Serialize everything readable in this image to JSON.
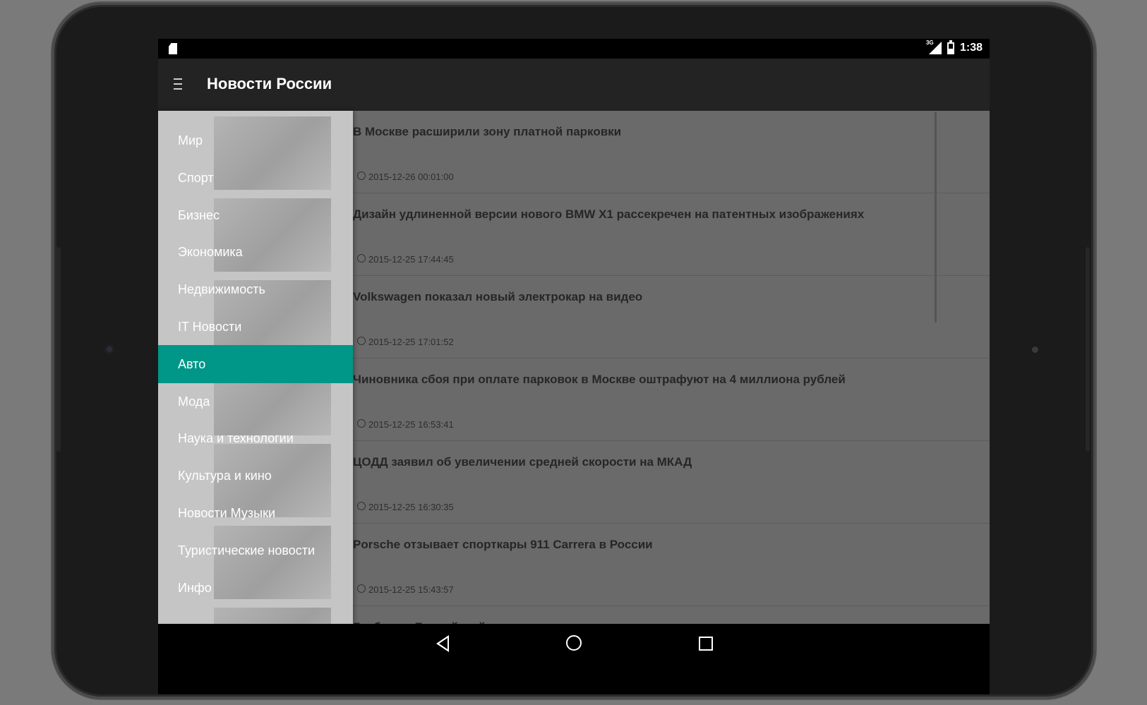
{
  "status_bar": {
    "time": "1:38",
    "network": "3G"
  },
  "app_bar": {
    "title": "Новости России",
    "menu_icon": "hamburger-icon"
  },
  "drawer": {
    "items": [
      {
        "label": "Мир"
      },
      {
        "label": "Спорт"
      },
      {
        "label": "Бизнес"
      },
      {
        "label": "Экономика"
      },
      {
        "label": "Недвижимость"
      },
      {
        "label": "IT Новости"
      },
      {
        "label": "Авто",
        "active": true
      },
      {
        "label": "Мода"
      },
      {
        "label": "Наука и технологии"
      },
      {
        "label": "Культура и кино"
      },
      {
        "label": "Новости Музыки"
      },
      {
        "label": "Туристические новости"
      },
      {
        "label": "Инфо"
      }
    ],
    "active_color": "#009688"
  },
  "news": [
    {
      "title": "В Москве расширили зону платной парковки",
      "date": "2015-12-26 00:01:00"
    },
    {
      "title": "Дизайн удлиненной версии нового BMW X1 рассекречен на патентных изображениях",
      "date": "2015-12-25 17:44:45"
    },
    {
      "title": "Volkswagen показал новый электрокар на видео",
      "date": "2015-12-25 17:01:52"
    },
    {
      "title": "Чиновника сбоя при оплате парковок в Москве оштрафуют на 4 миллиона рублей",
      "date": "2015-12-25 16:53:41"
    },
    {
      "title": "ЦОДД заявил об увеличении средней скорости на МКАД",
      "date": "2015-12-25 16:30:35"
    },
    {
      "title": "Porsche отзывает спорткары 911 Carrera в России",
      "date": "2015-12-25 15:43:57"
    },
    {
      "title": "Глубокие. Балтийский тоннель сдали в эксплуатацию",
      "date": ""
    }
  ]
}
